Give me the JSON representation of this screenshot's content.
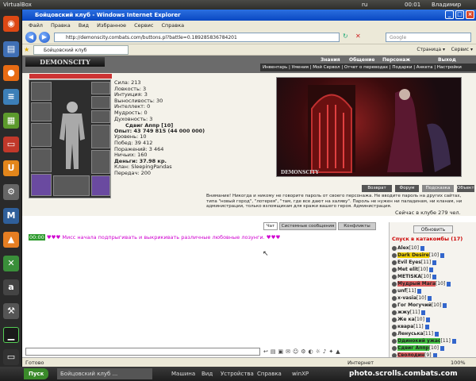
{
  "ubuntu_bar": {
    "title": "VirtualBox",
    "indicators": [
      "ru",
      "00:01",
      "Владимир"
    ]
  },
  "window": {
    "title": "Бойцовский клуб - Windows Internet Explorer"
  },
  "menu": [
    "Файл",
    "Правка",
    "Вид",
    "Избранное",
    "Сервис",
    "Справка"
  ],
  "address": {
    "url": "http://demonscity.combats.com/buttons.pl?battle=0.189285836784201",
    "search_placeholder": "Google"
  },
  "tab": {
    "title": "Бойцовский клуб",
    "tools": [
      "Страница ▾",
      "Сервис ▾"
    ]
  },
  "game": {
    "logo": "DEMONSCITY",
    "nav_top": [
      "Знания",
      "Общение",
      "Персонаж",
      "Выход"
    ],
    "nav_sub": "Инвентарь | Умения | Мой Сервол | Отчет о переводах | Подарки | Анкета | Настройки"
  },
  "character": {
    "nick": "Сдвиг Аппр",
    "level": "[10]",
    "stats": [
      "Сила: 213",
      "Ловкость: 3",
      "Интуиция: 3",
      "Выносливость: 30",
      "Интеллект: 0",
      "Мудрость: 0",
      "Духовность: 3",
      "",
      "Опыт: 43 749 815 (44 000 000)",
      "Уровень: 10",
      "Побед: 39 412",
      "Поражений: 3 464",
      "Ничьих: 160",
      "Деньги: 37.98 кр.",
      "Клан: SleepingPandas",
      "Передач: 200"
    ]
  },
  "scene": {
    "label": "DEMONSCITY"
  },
  "scene_buttons": [
    "Возврат",
    "Форум",
    "Подсказка",
    "Объекты"
  ],
  "warning": "Внимание! Никогда и никому не говорите пароль от своего персонажа. Не вводите пароль на других сайтах, типа \"новый город\", \"лотерея\", \"там, где все дают на халяву\". Пароль не нужен ни паладинам, ни кланам, ни администрации, только взломщикам для кражи вашего героя. Администрация.",
  "online": "Сейчас в клубе 279 чел.",
  "chat": {
    "tabs": [
      "Чат",
      "Системные сообщения",
      "Конфликты"
    ],
    "line_time": "00:00",
    "line_text": "♥♥♥ Мисс начала подпрыгивать и выкрикивать различные любовные лозунги. ♥♥♥"
  },
  "room": {
    "refresh": "Обновить",
    "title": "Спуск в катакомбы (17)",
    "players": [
      {
        "name": "Alex",
        "level": "[10]"
      },
      {
        "name": "Dark Desire",
        "level": "[10]"
      },
      {
        "name": "Evil Eyes",
        "level": "[11]"
      },
      {
        "name": "Met elit",
        "level": "[10]"
      },
      {
        "name": "METISKA",
        "level": "[10]"
      },
      {
        "name": "Мудрый Мага",
        "level": "[10]"
      },
      {
        "name": "unf",
        "level": "[11]"
      },
      {
        "name": "x-vasia",
        "level": "[10]"
      },
      {
        "name": "Гог Могучий",
        "level": "[10]"
      },
      {
        "name": "жжу",
        "level": "[11]"
      },
      {
        "name": "Же ка",
        "level": "[10]"
      },
      {
        "name": "кварa",
        "level": "[11]"
      },
      {
        "name": "Ленуська",
        "level": "[11]"
      },
      {
        "name": "Одинокий ужас",
        "level": "[11]"
      },
      {
        "name": "Сдвиг Аппр",
        "level": "[10]"
      },
      {
        "name": "Сволодин",
        "level": "[9]"
      }
    ],
    "colors": {
      "dark_desire_bg": "#f0d000",
      "mudry_bg": "#e06060",
      "odinoky_bg": "#40c040",
      "sdvig_bg": "#40c040",
      "svolodin_bg": "#e06060"
    }
  },
  "statusbar": {
    "left": "Готово",
    "zone": "Интернет",
    "zoom": "100%"
  },
  "taskbar": {
    "start": "Пуск",
    "task": "Бойцовский клуб ...",
    "vm_menu": [
      "Машина",
      "Вид",
      "Устройства",
      "Справка"
    ],
    "winxp": "winXP",
    "watermark": "photo.scrolls.combats.com"
  }
}
